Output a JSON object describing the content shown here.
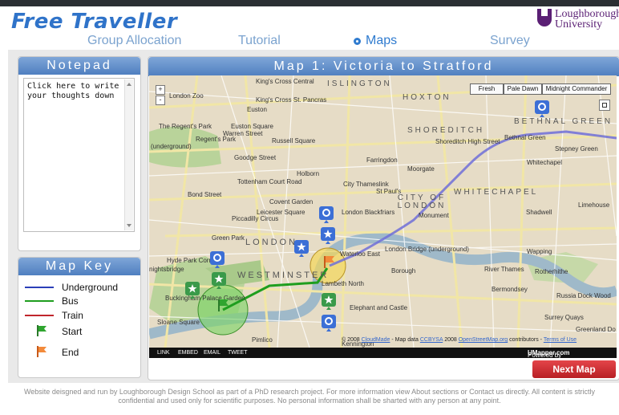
{
  "header": {
    "logo": "Free Traveller",
    "university_line1": "Loughborough",
    "university_line2": "University"
  },
  "nav": [
    {
      "label": "Group Allocation",
      "active": false
    },
    {
      "label": "Tutorial",
      "active": false
    },
    {
      "label": "Maps",
      "active": true
    },
    {
      "label": "Survey",
      "active": false
    }
  ],
  "notepad": {
    "title": "Notepad",
    "placeholder": "Click here to write your thoughts down"
  },
  "map_key": {
    "title": "Map Key",
    "items": [
      {
        "label": "Underground",
        "color": "#2b3fb8",
        "kind": "line"
      },
      {
        "label": "Bus",
        "color": "#1f9e1f",
        "kind": "line"
      },
      {
        "label": "Train",
        "color": "#c0262c",
        "kind": "line"
      },
      {
        "label": "Start",
        "color": "#2a9a2a",
        "kind": "flag"
      },
      {
        "label": "End",
        "color": "#f07a2a",
        "kind": "flag"
      }
    ]
  },
  "map": {
    "title": "Map 1: Victoria to Stratford",
    "style_buttons": [
      "Fresh",
      "Pale Dawn",
      "Midnight Commander"
    ],
    "zoom_in": "+",
    "zoom_out": "-",
    "labels": [
      "King's Cross Central",
      "ISLINGTON",
      "HOXTON",
      "London Zoo",
      "King's Cross St. Pancras",
      "Euston",
      "SHOREDITCH",
      "BETHNAL GREEN",
      "Shoreditch High Street",
      "Bethnal Green",
      "Stepney Green",
      "The Regent's Park",
      "Euston Square",
      "Warren Street",
      "Regent's Park",
      "(underground)",
      "Russell Square",
      "Farringdon",
      "Goodge Street",
      "Moorgate",
      "Whitechapel",
      "Holborn",
      "Tottenham Court Road",
      "City Thameslink",
      "St Paul's",
      "WHITECHAPEL",
      "CITY OF LONDON",
      "Bond Street",
      "Covent Garden",
      "Leicester Square",
      "Piccadilly Circus",
      "London Blackfriars",
      "Monument",
      "Shadwell",
      "Limehouse",
      "Green Park",
      "LONDON",
      "Waterloo East",
      "London Bridge (underground)",
      "Wapping",
      "Hyde Park Corner",
      "nightsbridge",
      "WESTMINSTER",
      "Borough",
      "River Thames",
      "Rotherhithe",
      "Buckingham Palace Garden",
      "Lambeth North",
      "Bermondsey",
      "Russia Dock Wood",
      "Elephant and Castle",
      "Surrey Quays",
      "Sloane Square",
      "Greenland Do",
      "Pimlico",
      "Kennington"
    ],
    "attribution_left": "© 2008",
    "attribution_cloudmade": "CloudMade",
    "attribution_mid": "- Map data",
    "attribution_ccbysa": "CCBYSA",
    "attribution_year": "2008",
    "attribution_osm": "OpenStreetMap.org",
    "attribution_contrib": "contributors -",
    "attribution_terms": "Terms of Use",
    "bar_links": [
      "LINK",
      "EMBED",
      "EMAIL",
      "TWEET"
    ],
    "powered_by": "Powered by",
    "powered_brand": "UMapper.com"
  },
  "next_button": "Next Map",
  "footer": {
    "line1": "Website deisgned and run by Loughborough Design School as part of a PhD research project. For more information view About sections or Contact us directly. All content is strictly",
    "line2": "confidential and used only for scientific purposes. No personal information shall be sharted with any person at any point."
  }
}
